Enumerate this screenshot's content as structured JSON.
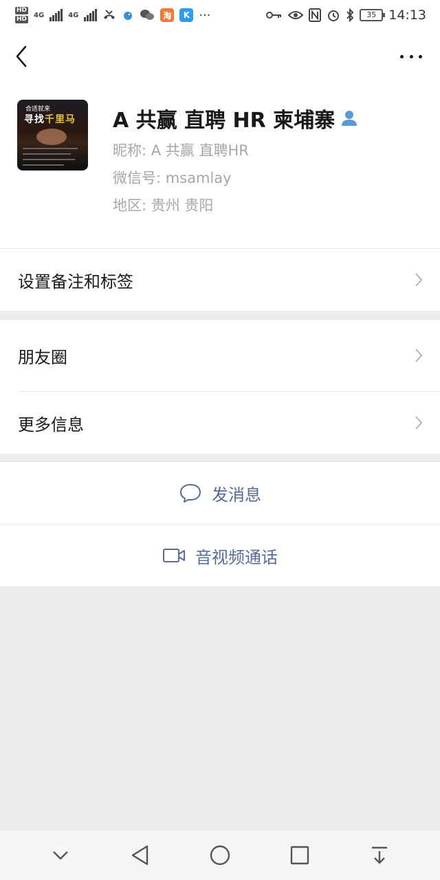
{
  "status_bar": {
    "network_1": "4G",
    "network_2": "4G",
    "hd_1": "HD",
    "hd_2": "HD",
    "app_badge_1": "K",
    "overflow": "···",
    "battery": "35",
    "time": "14:13"
  },
  "nav": {
    "back_icon": "chevron-left-icon",
    "more_icon": "more-dots-icon"
  },
  "avatar": {
    "top_text": "合适就来",
    "main_text_a": "寻找",
    "main_text_b": "千里马"
  },
  "profile": {
    "name": "A 共赢 直聘 HR 柬埔寨",
    "nickname": "昵称:  A 共赢 直聘HR",
    "wechat_id": "微信号:  msamlay",
    "region": "地区:  贵州  贵阳"
  },
  "rows": {
    "remark_tags": "设置备注和标签",
    "moments": "朋友圈",
    "more_info": "更多信息"
  },
  "actions": {
    "send_message": "发消息",
    "av_call": "音视频通话"
  },
  "colors": {
    "accent": "#576b95",
    "secondary_text": "#a6a6a6",
    "background": "#ededed",
    "user_icon": "#5b9bd5"
  }
}
